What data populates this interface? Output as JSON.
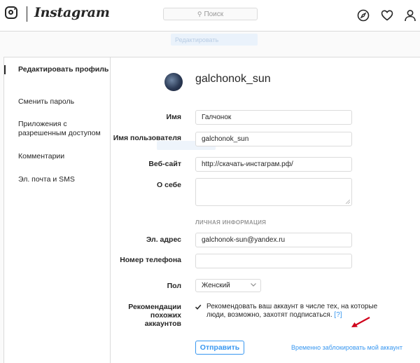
{
  "header": {
    "brand": "Instagram",
    "search_placeholder": "Поиск"
  },
  "toolbar_ghost_label": "Редактировать",
  "sidebar": {
    "items": [
      {
        "label": "Редактировать профиль",
        "active": true
      },
      {
        "label": "Сменить пароль",
        "active": false
      },
      {
        "label": "Приложения с разрешенным доступом",
        "active": false
      },
      {
        "label": "Комментарии",
        "active": false
      },
      {
        "label": "Эл. почта и SMS",
        "active": false
      }
    ]
  },
  "profile": {
    "username": "galchonok_sun"
  },
  "form": {
    "name_label": "Имя",
    "name_value": "Галчонок",
    "username_label": "Имя пользователя",
    "username_value": "galchonok_sun",
    "website_label": "Веб-сайт",
    "website_value": "http://скачать-инстаграм.рф/",
    "bio_label": "О себе",
    "bio_value": "",
    "private_section": "ЛИЧНАЯ ИНФОРМАЦИЯ",
    "email_label": "Эл. адрес",
    "email_value": "galchonok-sun@yandex.ru",
    "phone_label": "Номер телефона",
    "phone_value": "",
    "gender_label": "Пол",
    "gender_value": "Женский",
    "recommend_label": "Рекомендации похожих аккаунтов",
    "recommend_text": "Рекомендовать ваш аккаунт в числе тех, на которые люди, возможно, захотят подписаться.",
    "recommend_help": "[?]",
    "recommend_checked": true,
    "submit_label": "Отправить",
    "disable_link": "Временно заблокировать мой аккаунт"
  },
  "colors": {
    "accent": "#3897f0",
    "annotation_arrow": "#d0021b"
  }
}
